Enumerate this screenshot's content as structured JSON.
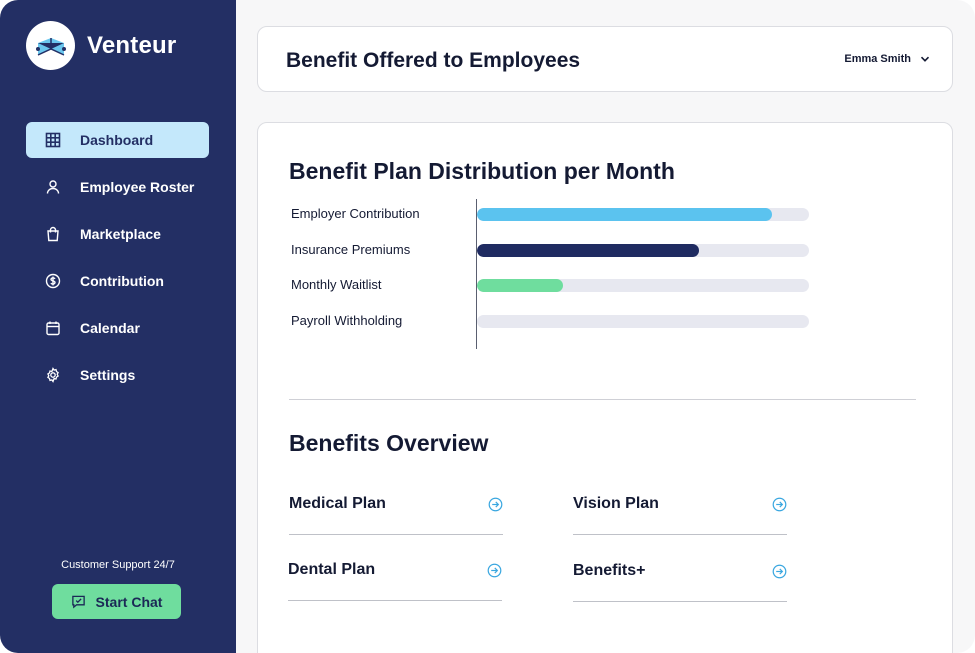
{
  "brand": {
    "name": "Venteur",
    "logo_icon": "venteur-logo-icon"
  },
  "sidebar": {
    "items": [
      {
        "label": "Dashboard",
        "icon": "grid-icon",
        "active": true
      },
      {
        "label": "Employee Roster",
        "icon": "user-icon",
        "active": false
      },
      {
        "label": "Marketplace",
        "icon": "shopping-bag-icon",
        "active": false
      },
      {
        "label": "Contribution",
        "icon": "dollar-circle-icon",
        "active": false
      },
      {
        "label": "Calendar",
        "icon": "calendar-icon",
        "active": false
      },
      {
        "label": "Settings",
        "icon": "gear-icon",
        "active": false
      }
    ],
    "support_text": "Customer Support 24/7",
    "chat_button_label": "Start Chat"
  },
  "header": {
    "title": "Benefit Offered to Employees",
    "user_name": "Emma Smith"
  },
  "chart_section": {
    "title": "Benefit Plan Distribution per Month"
  },
  "chart_data": {
    "type": "bar",
    "orientation": "horizontal",
    "categories": [
      "Employer Contribution",
      "Insurance Premiums",
      "Monthly Waitlist",
      "Payroll Withholding"
    ],
    "values": [
      0.89,
      0.67,
      0.26,
      0
    ],
    "colors": [
      "#5bc3ef",
      "#1f2b61",
      "#6fdd9e",
      "#e7e8f0"
    ],
    "track_color": "#e7e8f0",
    "xlim": [
      0,
      1
    ]
  },
  "overview": {
    "title": "Benefits Overview",
    "plans": [
      {
        "label": "Medical Plan",
        "icon": "arrow-right-circle-icon"
      },
      {
        "label": "Vision Plan",
        "icon": "arrow-right-circle-icon"
      },
      {
        "label": "Dental Plan",
        "icon": "arrow-right-circle-icon"
      },
      {
        "label": "Benefits+",
        "icon": "arrow-right-circle-icon"
      }
    ]
  },
  "colors": {
    "sidebar_bg": "#232f64",
    "active_item_bg": "#c4e8fb",
    "chat_button_bg": "#6fdd9e",
    "accent_blue": "#3aa7e0"
  }
}
